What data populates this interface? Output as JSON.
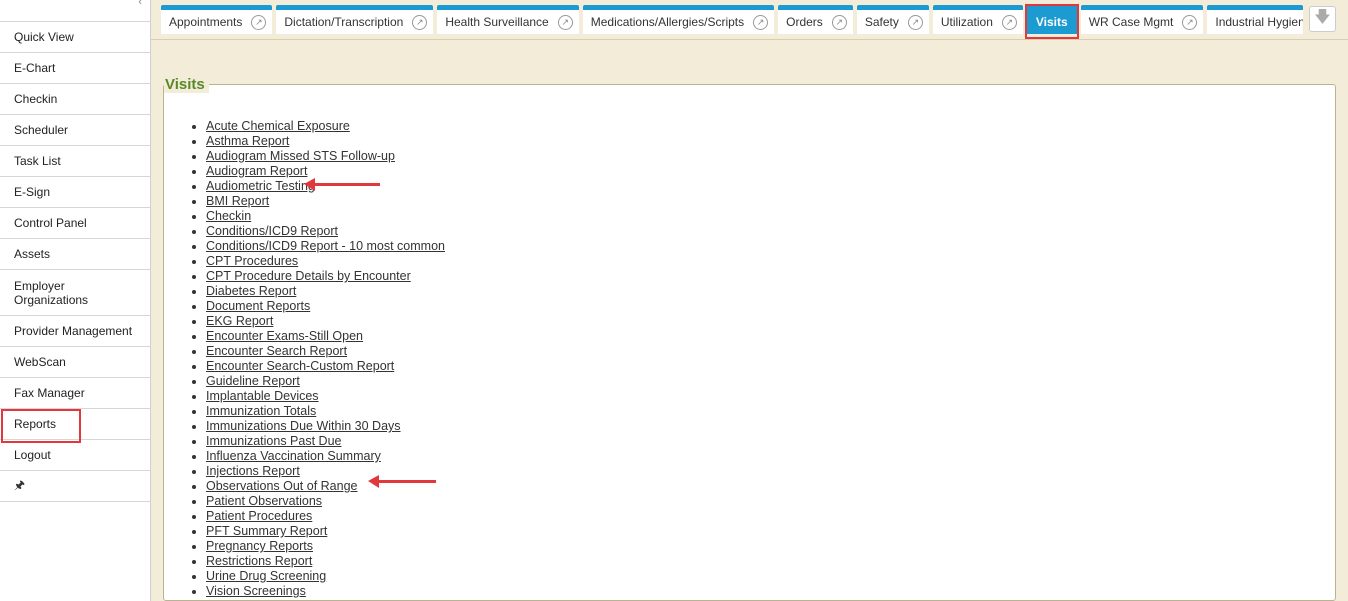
{
  "sidebar": {
    "items": [
      {
        "label": "Quick View"
      },
      {
        "label": "E-Chart"
      },
      {
        "label": "Checkin"
      },
      {
        "label": "Scheduler"
      },
      {
        "label": "Task List"
      },
      {
        "label": "E-Sign"
      },
      {
        "label": "Control Panel"
      },
      {
        "label": "Assets"
      },
      {
        "label": "Employer Organizations"
      },
      {
        "label": "Provider Management"
      },
      {
        "label": "WebScan"
      },
      {
        "label": "Fax Manager"
      },
      {
        "label": "Reports"
      },
      {
        "label": "Logout"
      }
    ],
    "pin_glyph": "🖈"
  },
  "tabs": [
    {
      "label": "Appointments"
    },
    {
      "label": "Dictation/Transcription"
    },
    {
      "label": "Health Surveillance"
    },
    {
      "label": "Medications/Allergies/Scripts"
    },
    {
      "label": "Orders"
    },
    {
      "label": "Safety"
    },
    {
      "label": "Utilization"
    },
    {
      "label": "Visits"
    },
    {
      "label": "WR Case Mgmt"
    },
    {
      "label": "Industrial Hygiene"
    }
  ],
  "section": {
    "title": "Visits",
    "reports": [
      "Acute Chemical Exposure",
      "Asthma Report",
      "Audiogram Missed STS Follow-up",
      "Audiogram Report",
      "Audiometric Testing",
      "BMI Report",
      "Checkin",
      "Conditions/ICD9 Report",
      "Conditions/ICD9 Report - 10 most common",
      "CPT Procedures",
      "CPT Procedure Details by Encounter",
      "Diabetes Report",
      "Document Reports",
      "EKG Report",
      "Encounter Exams-Still Open",
      "Encounter Search Report",
      "Encounter Search-Custom Report",
      "Guideline Report",
      "Implantable Devices",
      "Immunization Totals",
      "Immunizations Due Within 30 Days",
      "Immunizations Past Due",
      "Influenza Vaccination Summary",
      "Injections Report",
      "Observations Out of Range",
      "Patient Observations",
      "Patient Procedures",
      "PFT Summary Report",
      "Pregnancy Reports",
      "Restrictions Report",
      "Urine Drug Screening",
      "Vision Screenings"
    ]
  },
  "colors": {
    "tab_accent": "#1b9bd1",
    "highlight": "#e0383d",
    "legend_green": "#5a8a28",
    "panel_bg": "#f2ecd9"
  }
}
